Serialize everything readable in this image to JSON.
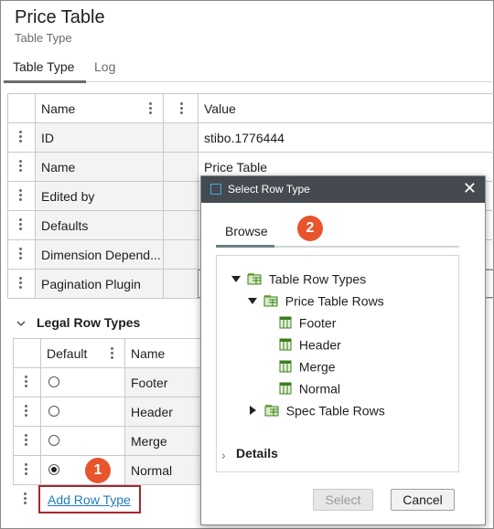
{
  "header": {
    "title": "Price Table",
    "subtitle": "Table Type"
  },
  "tabs": [
    {
      "label": "Table Type",
      "active": true
    },
    {
      "label": "Log",
      "active": false
    }
  ],
  "grid": {
    "columns": {
      "name": "Name",
      "value": "Value"
    },
    "rows": [
      {
        "name": "ID",
        "value": "stibo.1776444"
      },
      {
        "name": "Name",
        "value": "Price Table"
      },
      {
        "name": "Edited by",
        "value": ""
      },
      {
        "name": "Defaults",
        "value": ""
      },
      {
        "name": "Dimension Depend...",
        "value": ""
      },
      {
        "name": "Pagination Plugin",
        "value": ""
      }
    ]
  },
  "legal_row_types": {
    "title": "Legal Row Types",
    "columns": {
      "default": "Default",
      "name": "Name"
    },
    "rows": [
      {
        "name": "Footer",
        "default": false
      },
      {
        "name": "Header",
        "default": false
      },
      {
        "name": "Merge",
        "default": false
      },
      {
        "name": "Normal",
        "default": true
      }
    ],
    "add_link": "Add Row Type"
  },
  "dialog": {
    "title": "Select Row Type",
    "tab": "Browse",
    "tree": {
      "root": "Table Row Types",
      "group1": "Price Table Rows",
      "items": [
        "Footer",
        "Header",
        "Merge",
        "Normal"
      ],
      "group2": "Spec Table Rows"
    },
    "details": "Details",
    "select_label": "Select",
    "cancel_label": "Cancel"
  },
  "callouts": [
    "1",
    "2"
  ],
  "colors": {
    "accent_orange": "#e8542c",
    "highlight_red": "#a8262f",
    "link_blue": "#1f7bbf",
    "titlebar": "#444a50"
  }
}
